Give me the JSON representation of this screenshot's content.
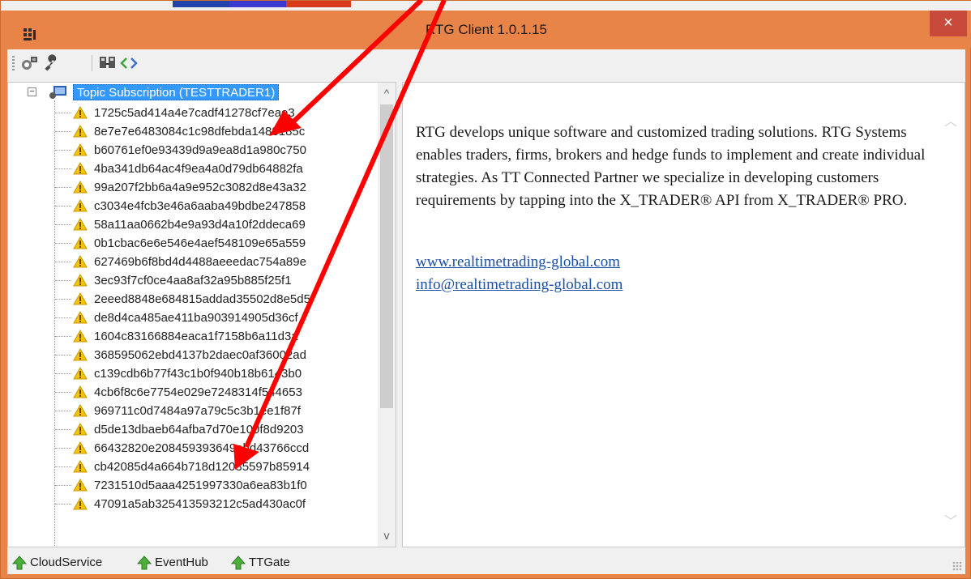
{
  "window": {
    "title": "RTG Client 1.0.1.15",
    "close_glyph": "×",
    "frame_color": "#e98449"
  },
  "toolbar": {
    "buttons": [
      "network-icon",
      "wrench-icon",
      "connect-icon",
      "code-icon"
    ]
  },
  "tree": {
    "root_label": "Topic Subscription (TESTTRADER1)",
    "expander_glyph": "−",
    "items": [
      "1725c5ad414a4e7cadf41278cf7eae3",
      "8e7e7e6483084c1c98dfebda1488185c",
      "b60761ef0e93439d9a9ea8d1a980c750",
      "4ba341db64ac4f9ea4a0d79db64882fa",
      "99a207f2bb6a4a9e952c3082d8e43a32",
      "c3034e4fcb3e46a6aaba49bdbe247858",
      "58a11aa0662b4e9a93d4a10f2ddeca69",
      "0b1cbac6e6e546e4aef548109e65a559",
      "627469b6f8bd4d4488aeeedac754a89e",
      "3ec93f7cf0ce4aa8af32a95b885f25f1",
      "2eeed8848e684815addad35502d8e5d5",
      "de8d4ca485ae411ba903914905d36cf",
      "1604c83166884eaca1f7158b6a11d3a",
      "368595062ebd4137b2daec0af36002ad",
      "c139cdb6b77f43c1b0f940b18b6143b0",
      "4cb6f8c6e7754e029e7248314f544653",
      "969711c0d7484a97a79c5c3b1ee1f87f",
      "d5de13dbaeb64afba7d70e100f8d9203",
      "66432820e208459393649ebd43766ccd",
      "cb42085d4a664b718d12035597b85914",
      "7231510d5aaa4251997330a6ea83b1f0",
      "47091a5ab325413593212c5ad430ac0f"
    ],
    "scroll_up_glyph": "^",
    "scroll_down_glyph": "v"
  },
  "info": {
    "description": "RTG develops unique software and customized trading solutions. RTG Systems enables traders, firms, brokers and hedge funds to implement and create individual strategies. As TT Connected Partner we specialize in developing customers requirements by tapping into the X_TRADER® API from X_TRADER® PRO.",
    "website": "www.realtimetrading-global.com",
    "email": "info@realtimetrading-global.com"
  },
  "statusbar": {
    "services": [
      {
        "label": "CloudService",
        "status": "up"
      },
      {
        "label": "EventHub",
        "status": "up"
      },
      {
        "label": "TTGate",
        "status": "up"
      }
    ],
    "status_color": "#4caf3a"
  },
  "annotation": {
    "arrow_color": "#ff0000",
    "arrow_count": 2
  }
}
